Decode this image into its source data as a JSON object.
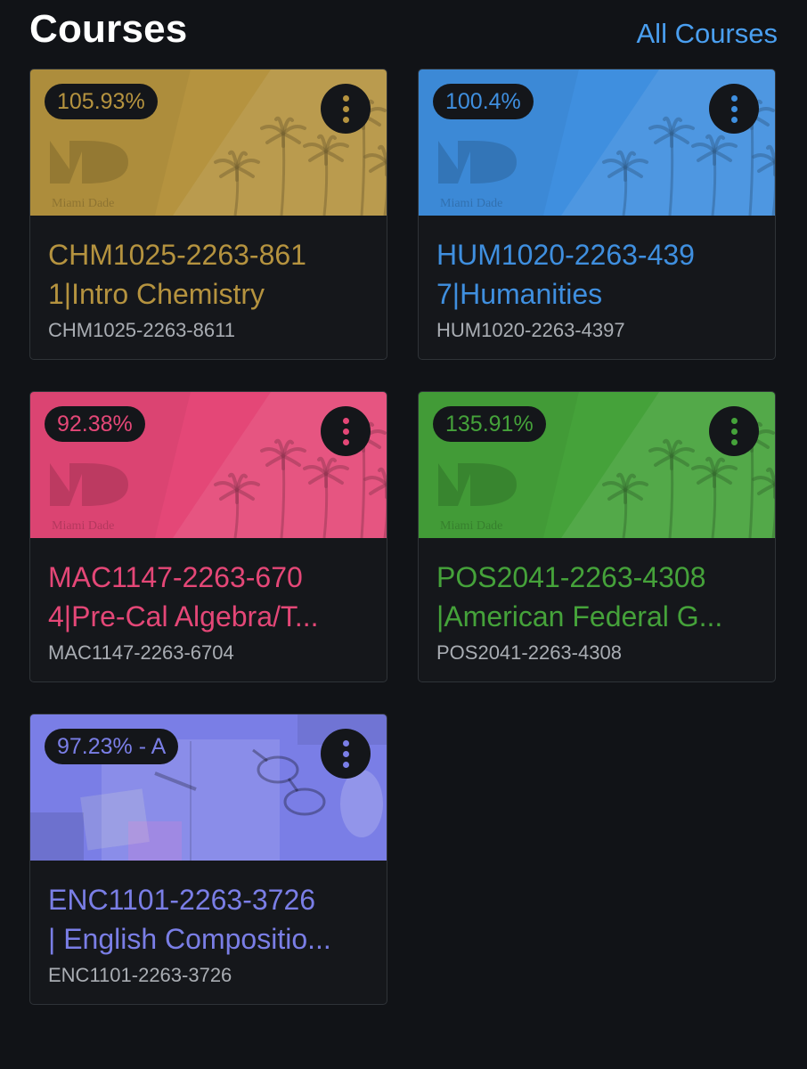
{
  "header": {
    "title": "Courses",
    "all_courses_link": "All Courses"
  },
  "courses": [
    {
      "grade": "105.93%",
      "title_line1": "CHM1025-2263-861",
      "title_line2": "1|Intro Chemistry",
      "code": "CHM1025-2263-8611",
      "color": "#b5933f",
      "hero": "college-logo",
      "logo_text": "Miami Dade"
    },
    {
      "grade": "100.4%",
      "title_line1": "HUM1020-2263-439",
      "title_line2": "7|Humanities",
      "code": "HUM1020-2263-4397",
      "color": "#3f8fdf",
      "hero": "college-logo",
      "logo_text": "Miami Dade"
    },
    {
      "grade": "92.38%",
      "title_line1": "MAC1147-2263-670",
      "title_line2": "4|Pre-Cal Algebra/T...",
      "code": "MAC1147-2263-6704",
      "color": "#e44777",
      "hero": "college-logo",
      "logo_text": "Miami Dade"
    },
    {
      "grade": "135.91%",
      "title_line1": "POS2041-2263-4308",
      "title_line2": "|American Federal G...",
      "code": "POS2041-2263-4308",
      "color": "#45a23a",
      "hero": "college-logo",
      "logo_text": "Miami Dade"
    },
    {
      "grade": "97.23% - A",
      "title_line1": "ENC1101-2263-3726",
      "title_line2": "| English Compositio...",
      "code": "ENC1101-2263-3726",
      "color": "#7a7ee6",
      "hero": "desk-photo"
    }
  ]
}
